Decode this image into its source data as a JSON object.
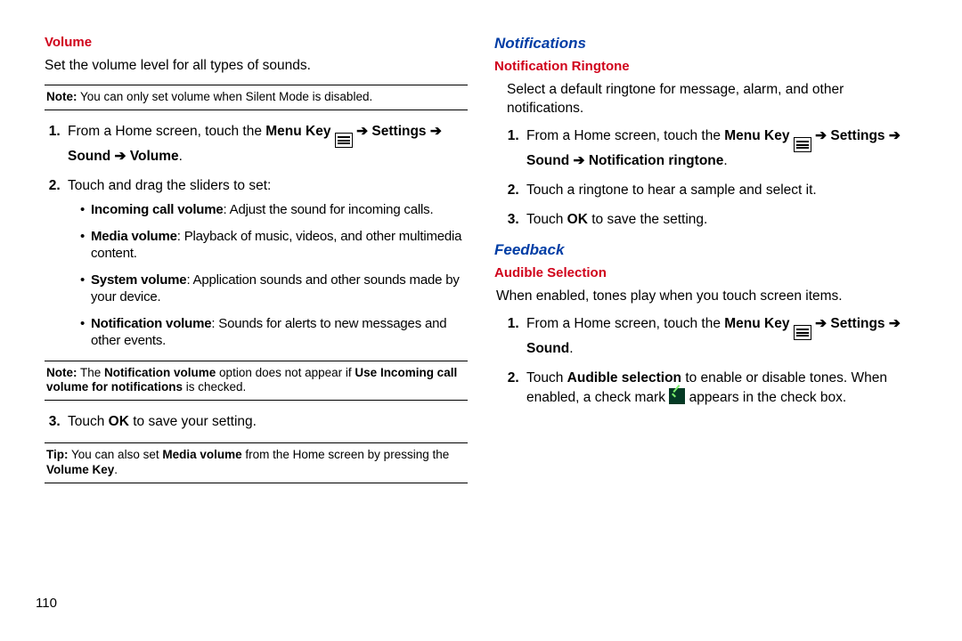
{
  "page_number": "110",
  "left": {
    "h_volume": "Volume",
    "volume_intro": "Set the volume level for all types of sounds.",
    "note1_lead": "Note:",
    "note1_body": " You can only set volume when Silent Mode is disabled.",
    "step1_pre": "From a Home screen, touch the ",
    "step1_menukey": "Menu Key",
    "step1_arrow1": " ➔ ",
    "step1_settings": "Settings",
    "step1_arrow2": " ➔ ",
    "step1_sound": "Sound",
    "step1_arrow3": " ➔ ",
    "step1_volume": "Volume",
    "step1_period": ".",
    "step2": "Touch and drag the sliders to set:",
    "b1_lead": "Incoming call volume",
    "b1_body": ": Adjust the sound for incoming calls.",
    "b2_lead": "Media volume",
    "b2_body": ": Playback of music, videos, and other multimedia content.",
    "b3_lead": "System volume",
    "b3_body": ": Application sounds and other sounds made by your device.",
    "b4_lead": "Notification volume",
    "b4_body": ": Sounds for alerts to new messages and other events.",
    "note2_lead": "Note:",
    "note2_a": " The ",
    "note2_b": "Notification volume",
    "note2_c": " option does not appear if ",
    "note2_d": "Use Incoming call volume for notifications",
    "note2_e": " is checked.",
    "step3_a": "Touch ",
    "step3_b": "OK",
    "step3_c": " to save your setting.",
    "tip_lead": "Tip:",
    "tip_a": " You can also set ",
    "tip_b": "Media volume",
    "tip_c": " from the Home screen by pressing the ",
    "tip_d": "Volume Key",
    "tip_e": "."
  },
  "right": {
    "h_notifications": "Notifications",
    "h_notif_ring": "Notification Ringtone",
    "nr_intro": "Select a default ringtone for message, alarm, and other notifications.",
    "nr1_pre": "From a Home screen, touch the ",
    "nr1_menukey": "Menu Key",
    "nr1_arrow1": " ➔ ",
    "nr1_settings": "Settings",
    "nr1_arrow2": " ➔ ",
    "nr1_sound": "Sound",
    "nr1_arrow3": " ➔ ",
    "nr1_target": "Notification ringtone",
    "nr1_period": ".",
    "nr2": "Touch a ringtone to hear a sample and select it.",
    "nr3_a": "Touch ",
    "nr3_b": "OK",
    "nr3_c": " to save the setting.",
    "h_feedback": "Feedback",
    "h_aud_sel": "Audible Selection",
    "as_intro": "When enabled, tones play when you touch screen items.",
    "as1_pre": "From a Home screen, touch the ",
    "as1_menukey": "Menu Key",
    "as1_arrow1": " ➔ ",
    "as1_settings": "Settings",
    "as1_arrow2": " ➔ ",
    "as1_sound": "Sound",
    "as1_period": ".",
    "as2_a": "Touch ",
    "as2_b": "Audible selection",
    "as2_c": " to enable or disable tones. When enabled, a check mark ",
    "as2_d": " appears in the check box."
  }
}
